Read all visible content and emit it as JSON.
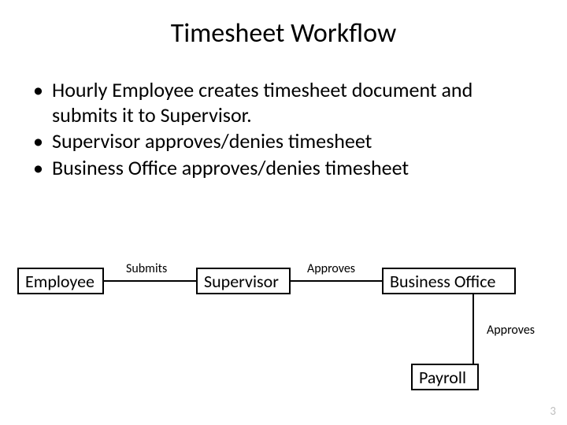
{
  "title": "Timesheet Workflow",
  "bullets": [
    "Hourly Employee creates timesheet document and submits it to Supervisor.",
    "Supervisor approves/denies timesheet",
    "Business Office approves/denies timesheet"
  ],
  "flow": {
    "nodes": {
      "employee": "Employee",
      "supervisor": "Supervisor",
      "business_office": "Business Office",
      "payroll": "Payroll"
    },
    "edges": {
      "submits": "Submits",
      "approves1": "Approves",
      "approves2": "Approves"
    }
  },
  "page_number": "3"
}
